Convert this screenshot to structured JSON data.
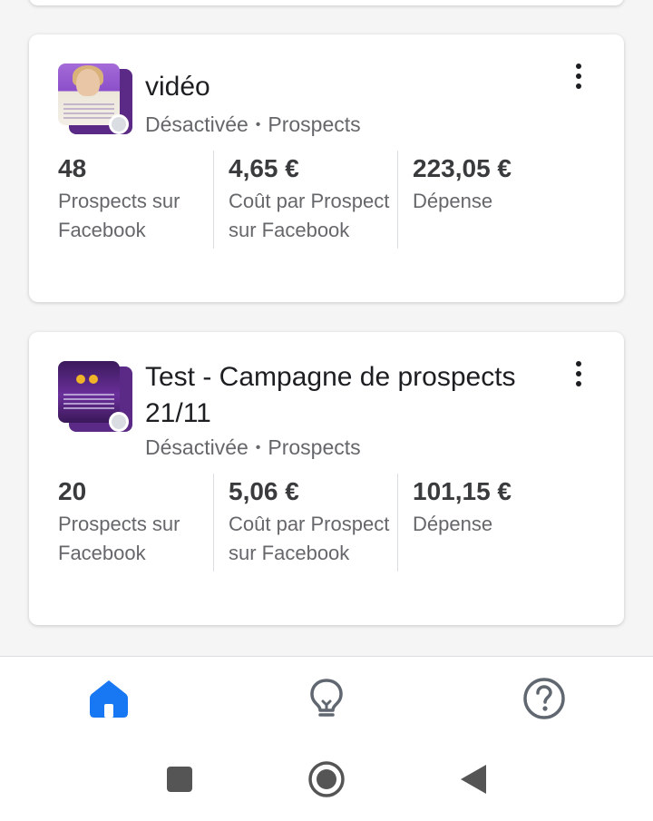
{
  "campaigns": [
    {
      "title": "vidéo",
      "status": "Désactivée",
      "objective": "Prospects",
      "separator": "•",
      "metrics": [
        {
          "value": "48",
          "label": "Prospects sur Facebook"
        },
        {
          "value": "4,65 €",
          "label": "Coût par Prospect sur Facebook"
        },
        {
          "value": "223,05 €",
          "label": "Dépense"
        }
      ]
    },
    {
      "title": "Test - Campagne de prospects 21/11",
      "status": "Désactivée",
      "objective": "Prospects",
      "separator": "•",
      "metrics": [
        {
          "value": "20",
          "label": "Prospects sur Facebook"
        },
        {
          "value": "5,06 €",
          "label": "Coût par Prospect sur Facebook"
        },
        {
          "value": "101,15 €",
          "label": "Dépense"
        }
      ]
    }
  ],
  "bottom_nav": {
    "items": [
      {
        "icon": "home-icon",
        "active": true
      },
      {
        "icon": "lightbulb-icon",
        "active": false
      },
      {
        "icon": "help-icon",
        "active": false
      }
    ]
  },
  "system_nav": [
    "recent-apps-icon",
    "home-circle-icon",
    "back-icon"
  ],
  "colors": {
    "accent": "#1877f2",
    "icon_inactive": "#606770",
    "text_secondary": "#65676b",
    "status_inactive": "#dadde1"
  }
}
